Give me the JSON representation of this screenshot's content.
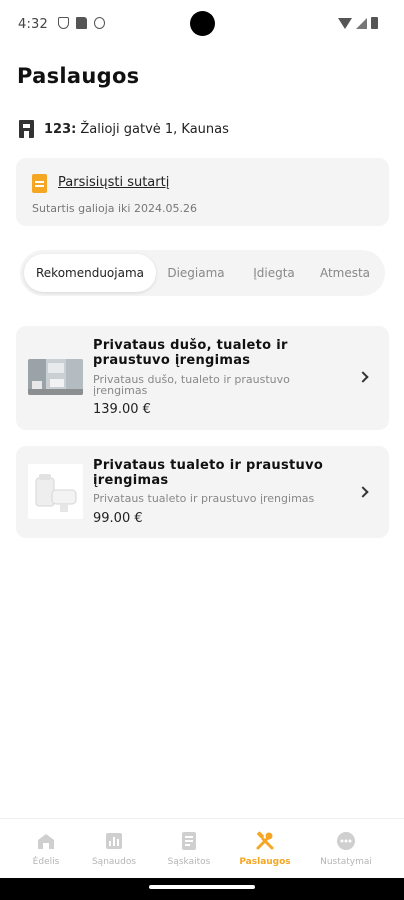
{
  "status_bar": {
    "time": "4:32",
    "left_icons": [
      "shield-icon",
      "sd-card-icon",
      "face-icon"
    ],
    "right_icons": [
      "wifi-icon",
      "signal-icon",
      "battery-icon"
    ]
  },
  "page": {
    "title": "Paslaugos"
  },
  "address": {
    "icon": "building-icon",
    "number": "123:",
    "street": "Žalioji gatvė 1, Kaunas"
  },
  "contract": {
    "icon": "document-icon",
    "icon_color": "#f5a623",
    "link_label": "Parsisiųsti sutartį",
    "valid_text": "Sutartis galioja iki 2024.05.26"
  },
  "tabs": [
    {
      "label": "Rekomenduojama",
      "active": true
    },
    {
      "label": "Diegiama",
      "active": false
    },
    {
      "label": "Įdiegta",
      "active": false
    },
    {
      "label": "Atmesta",
      "active": false
    }
  ],
  "services": [
    {
      "title": "Privataus dušo, tualeto ir praustuvo įrengimas",
      "description": "Privataus dušo, tualeto ir praustuvo įrengimas",
      "price": "139.00 €",
      "image": "bathroom-photo"
    },
    {
      "title": "Privataus tualeto ir praustuvo įrengimas",
      "description": "Privataus tualeto ir praustuvo įrengimas",
      "price": "99.00 €",
      "image": "toilet-sink-photo"
    }
  ],
  "bottom_nav": [
    {
      "label": "Ėdelis",
      "icon": "home-icon",
      "active": false
    },
    {
      "label": "Sąnaudos",
      "icon": "chart-icon",
      "active": false
    },
    {
      "label": "Sąskaitos",
      "icon": "invoice-icon",
      "active": false
    },
    {
      "label": "Paslaugos",
      "icon": "tools-icon",
      "active": true
    },
    {
      "label": "Nustatymai",
      "icon": "more-icon",
      "active": false
    }
  ],
  "colors": {
    "accent": "#f5a623",
    "card_bg": "#f4f4f4",
    "inactive_nav": "#b5b5b5"
  }
}
